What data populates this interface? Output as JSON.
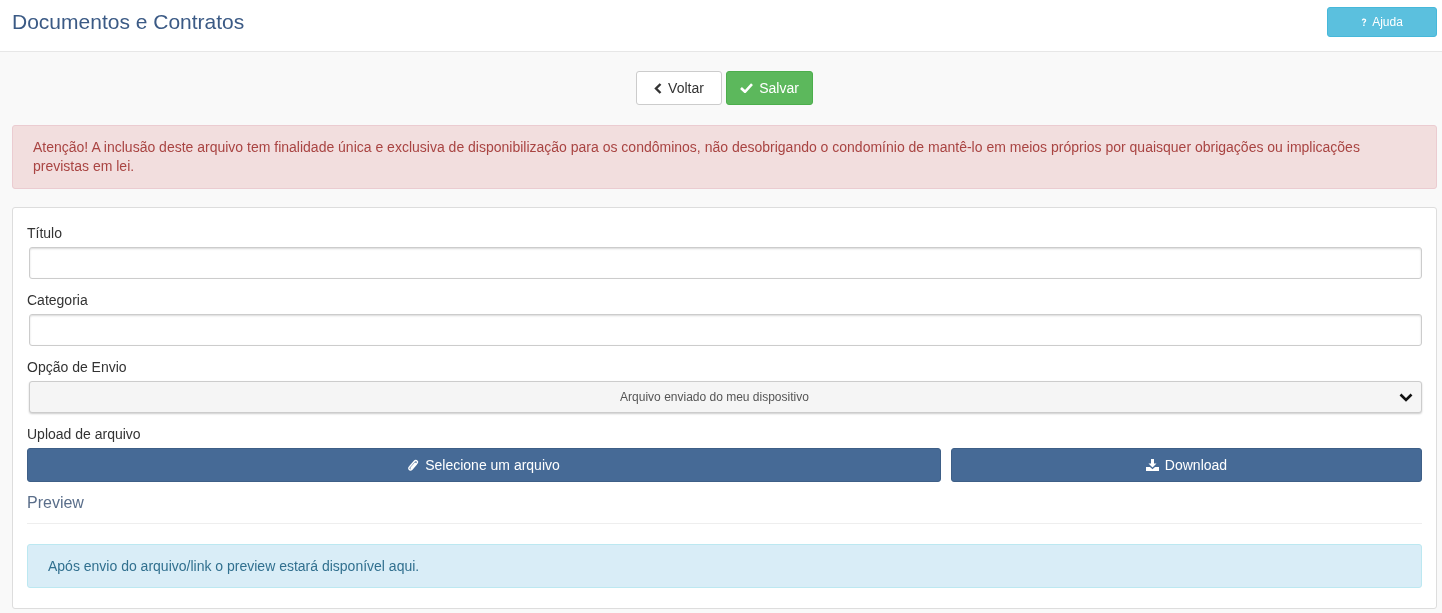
{
  "header": {
    "title": "Documentos e Contratos",
    "help_button": {
      "label": "Ajuda"
    }
  },
  "actions": {
    "back_button": {
      "label": "Voltar"
    },
    "save_button": {
      "label": "Salvar"
    }
  },
  "warning": "Atenção! A inclusão deste arquivo tem finalidade única e exclusiva de disponibilização para os condôminos, não desobrigando o condomínio de mantê-lo em meios próprios por quaisquer obrigações ou implicações previstas em lei.",
  "form": {
    "fields": [
      {
        "kind": "text",
        "label": "Título"
      },
      {
        "kind": "text",
        "label": "Categoria"
      },
      {
        "kind": "select",
        "label": "Opção de Envio",
        "value": "Arquivo enviado do meu dispositivo"
      }
    ],
    "upload": {
      "label": "Upload de arquivo",
      "select_button": "Selecione um arquivo",
      "download_button": "Download"
    },
    "preview": {
      "heading": "Preview",
      "message": "Após envio do arquivo/link o preview estará disponível aqui."
    }
  }
}
